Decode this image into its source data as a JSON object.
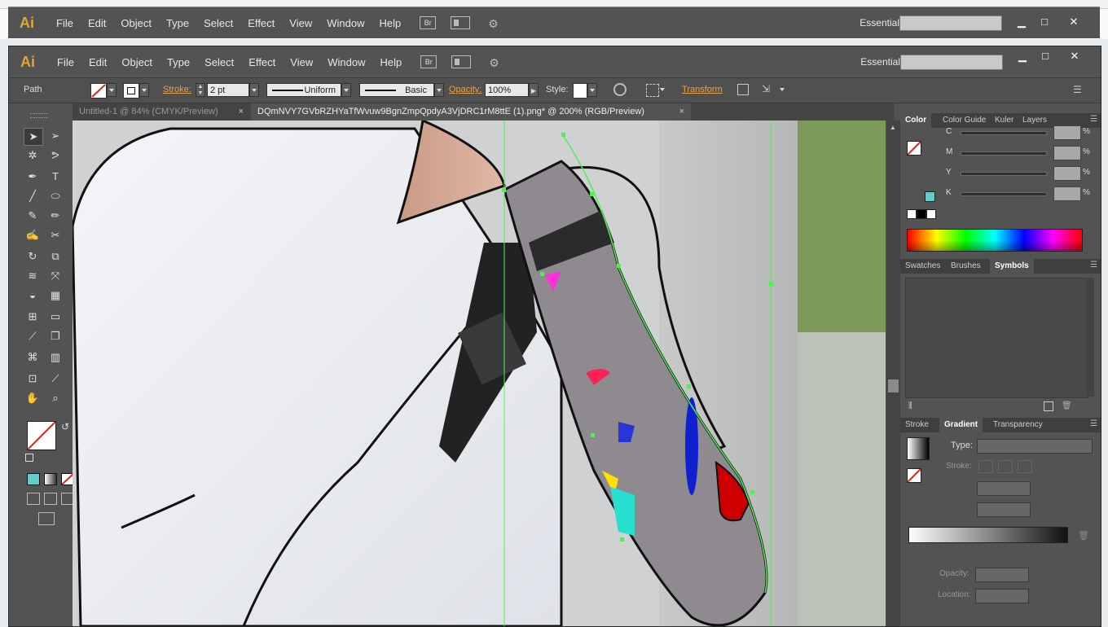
{
  "app": {
    "logo": "Ai"
  },
  "menu": [
    "File",
    "Edit",
    "Object",
    "Type",
    "Select",
    "Effect",
    "View",
    "Window",
    "Help"
  ],
  "bridge_label": "Br",
  "workspace": "Essentials",
  "background_window": {
    "menu": [
      "File",
      "Edit",
      "Object",
      "Type",
      "Select",
      "Effect",
      "View",
      "Window",
      "Help"
    ],
    "workspace": "Essentials"
  },
  "window_controls": {
    "minimize": "▁",
    "maximize": "□",
    "close": "✕"
  },
  "control_bar": {
    "selection_type": "Path",
    "stroke_label": "Stroke:",
    "stroke_weight": "2 pt",
    "profile": "Uniform",
    "brush": "Basic",
    "opacity_label": "Opacity:",
    "opacity_value": "100%",
    "style_label": "Style:",
    "transform_label": "Transform"
  },
  "tabs": [
    {
      "label": "Untitled-1 @ 84% (CMYK/Preview)",
      "active": false
    },
    {
      "label": "DQmNVY7GVbRZHYaTfWvuw9BgnZmpQpdyA3VjDRC1rM8ttE (1).png* @ 200% (RGB/Preview)",
      "active": true
    }
  ],
  "color_panel": {
    "tabs": [
      "Color",
      "Color Guide",
      "Kuler",
      "Layers"
    ],
    "channels": [
      {
        "name": "C",
        "value": ""
      },
      {
        "name": "M",
        "value": ""
      },
      {
        "name": "Y",
        "value": ""
      },
      {
        "name": "K",
        "value": ""
      }
    ],
    "percent": "%"
  },
  "symbols_panel": {
    "tabs": [
      "Swatches",
      "Brushes",
      "Symbols"
    ]
  },
  "gradient_panel": {
    "tabs": [
      "Stroke",
      "Gradient",
      "Transparency"
    ],
    "type_label": "Type:",
    "stroke_label": "Stroke:",
    "opacity_label": "Opacity:",
    "location_label": "Location:"
  },
  "colors": {
    "ui_dark": "#535353",
    "accent_orange": "#e8a24a",
    "guide_green": "#4ff04f",
    "swatch_teal": "#67c9c9"
  }
}
